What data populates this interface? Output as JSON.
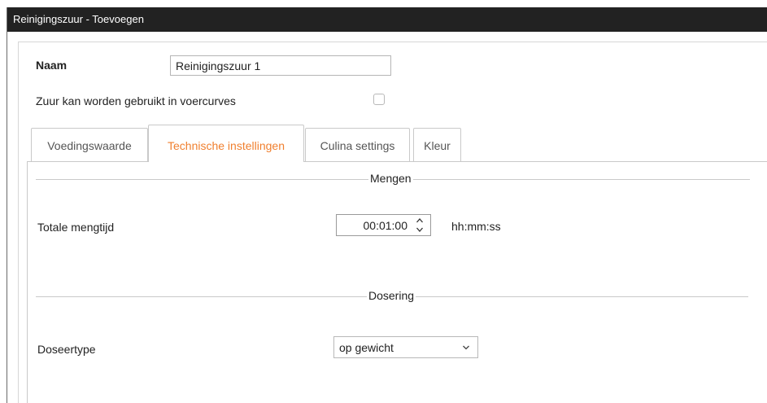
{
  "window": {
    "title": "Reinigingszuur - Toevoegen"
  },
  "form": {
    "name_label": "Naam",
    "name_value": "Reinigingszuur 1",
    "curves_label": "Zuur kan worden gebruikt in voercurves",
    "curves_checked": false
  },
  "tabs": [
    {
      "label": "Voedingswaarde",
      "active": false
    },
    {
      "label": "Technische instellingen",
      "active": true
    },
    {
      "label": "Culina settings",
      "active": false
    },
    {
      "label": "Kleur",
      "active": false
    }
  ],
  "mixing": {
    "section_title": "Mengen",
    "total_label": "Totale mengtijd",
    "total_value": "00:01:00",
    "unit": "hh:mm:ss"
  },
  "dosing": {
    "section_title": "Dosering",
    "type_label": "Doseertype",
    "type_value": "op gewicht"
  },
  "icons": {
    "spinner": "spinner-up-down-icon",
    "dropdown": "chevron-down-icon"
  },
  "colors": {
    "titlebar_bg": "#222222",
    "active_tab_text": "#f07f2e"
  }
}
